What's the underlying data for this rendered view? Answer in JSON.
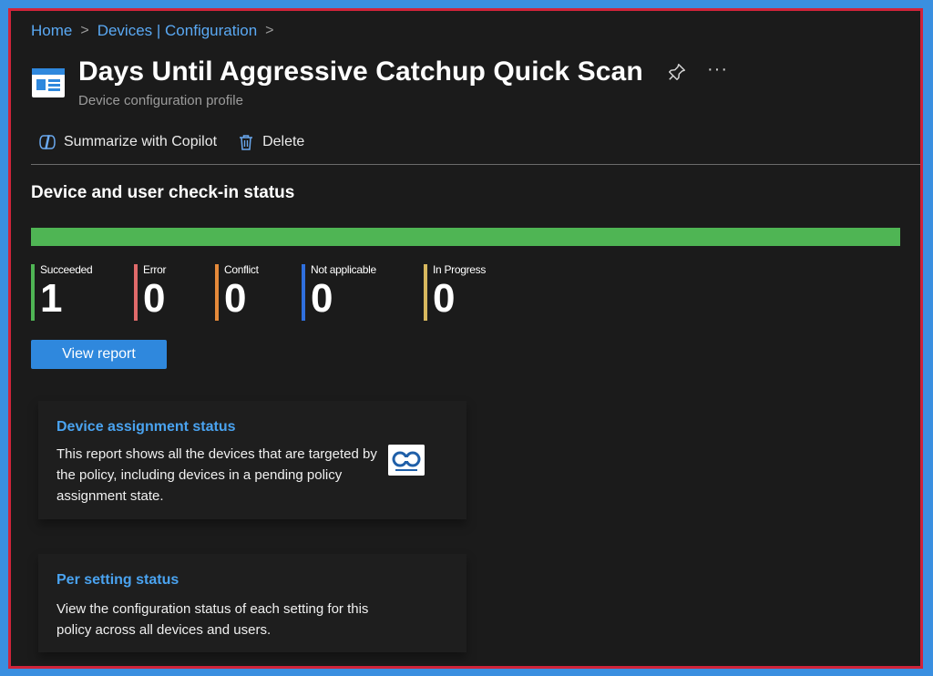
{
  "breadcrumb": {
    "home": "Home",
    "section": "Devices | Configuration",
    "sep": ">"
  },
  "header": {
    "title": "Days Until Aggressive Catchup Quick Scan",
    "subtitle": "Device configuration profile",
    "more": "···"
  },
  "toolbar": {
    "copilot_label": "Summarize with Copilot",
    "delete_label": "Delete"
  },
  "status": {
    "title": "Device and user check-in status",
    "progress_fraction": 1.0,
    "metrics": [
      {
        "label": "Succeeded",
        "value": "1",
        "color": "#4fb554"
      },
      {
        "label": "Error",
        "value": "0",
        "color": "#e06a6a"
      },
      {
        "label": "Conflict",
        "value": "0",
        "color": "#e58a3a"
      },
      {
        "label": "Not applicable",
        "value": "0",
        "color": "#2f6fde"
      },
      {
        "label": "In Progress",
        "value": "0",
        "color": "#d8b85e"
      }
    ],
    "view_report_label": "View report"
  },
  "cards": [
    {
      "title": "Device assignment status",
      "description": "This report shows all the devices that are targeted by the policy, including devices in a pending policy assignment state."
    },
    {
      "title": "Per setting status",
      "description": "View the configuration status of each setting for this policy across all devices and users."
    }
  ],
  "colors": {
    "accent": "#2f88dd",
    "link": "#4aa3f0",
    "success": "#4fb554",
    "background": "#1b1b1b"
  }
}
